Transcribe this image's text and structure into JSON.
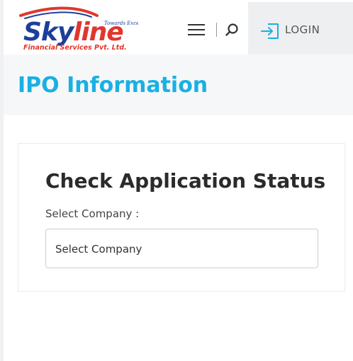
{
  "header": {
    "logo": {
      "brand": "Skyline",
      "tagline": "Towards Excellence",
      "company": "Financial Services Pvt. Ltd."
    },
    "menu_icon": "hamburger-menu-icon",
    "search_icon": "search-icon",
    "login_icon": "login-icon",
    "login_label": "LOGIN"
  },
  "page": {
    "title": "IPO Information"
  },
  "form": {
    "heading": "Check Application Status",
    "company_label": "Select Company :",
    "company_select_value": "Select Company"
  },
  "colors": {
    "accent": "#1ab0e3",
    "logo_blue": "#1d3f9a",
    "logo_red": "#e2362c"
  }
}
